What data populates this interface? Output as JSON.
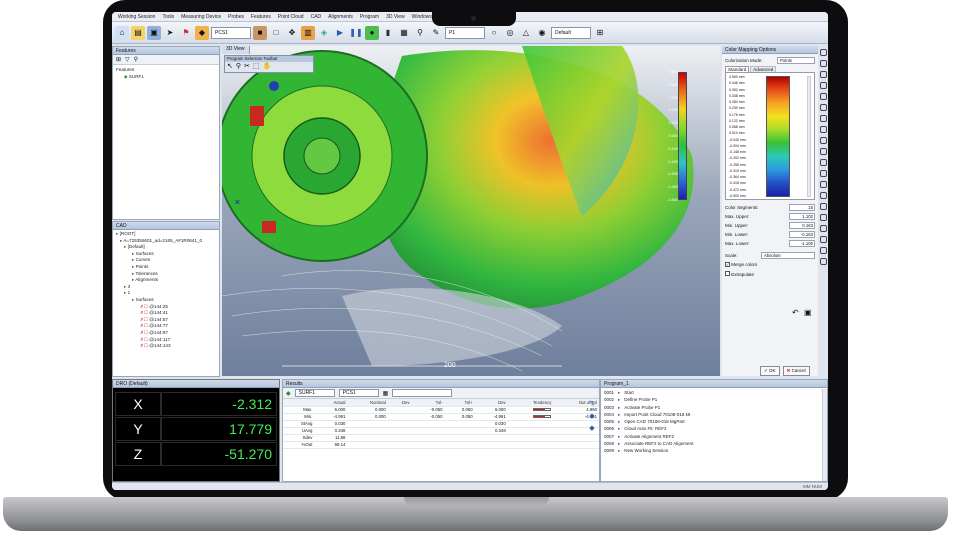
{
  "menu": [
    "Working Session",
    "Tools",
    "Measuring Device",
    "Probes",
    "Features",
    "Point Cloud",
    "CAD",
    "Alignments",
    "Program",
    "3D View",
    "Windows"
  ],
  "toolbar": {
    "frame_select": "PCS1",
    "probe_select": "P1",
    "view_select": "Default"
  },
  "features_panel": {
    "title": "Features",
    "items": [
      "Features",
      "SURF1"
    ]
  },
  "cad_panel": {
    "title": "CAD",
    "items": [
      "[ROOT]",
      "A=725355601_ad=2165_A#1R0641_0",
      "[Default]",
      "Surfaces",
      "Curves",
      "Points",
      "Tolerances",
      "Alignments",
      "3",
      "1",
      "Surfaces",
      "@144:25",
      "@144:41",
      "@144:57",
      "@144:77",
      "@144:97",
      "@144:117",
      "@144:143"
    ]
  },
  "view3d": {
    "tab": "3D View",
    "subwindow_title": "Program Selection Toolbar",
    "scale_label": "200"
  },
  "legend_values": [
    "0.500",
    "0.400",
    "0.300",
    "0.200",
    "0.100",
    "0.000",
    "-0.100",
    "-0.200",
    "-0.300",
    "-0.400",
    "-0.500"
  ],
  "color_mapping": {
    "title": "Color Mapping Options",
    "mode_label": "Colorization Mode:",
    "mode_value": "Points",
    "tabs": [
      "Standard",
      "Advanced"
    ],
    "segments_values": [
      "0.500 mm",
      "0.446 mm",
      "0.392 mm",
      "0.338 mm",
      "0.284 mm",
      "0.230 mm",
      "0.176 mm",
      "0.122 mm",
      "0.068 mm",
      "0.014 mm",
      "-0.040 mm",
      "-0.094 mm",
      "-0.148 mm",
      "-0.202 mm",
      "-0.256 mm",
      "-0.310 mm",
      "-0.364 mm",
      "-0.418 mm",
      "-0.472 mm",
      "-0.500 mm"
    ],
    "fields": [
      {
        "label": "Color Segments:",
        "value": "15"
      },
      {
        "label": "Max. Upper:",
        "value": "1.102"
      },
      {
        "label": "Min. Upper:",
        "value": "0.163"
      },
      {
        "label": "Min. Lower:",
        "value": "-0.163"
      },
      {
        "label": "Max. Lower:",
        "value": "-1.100"
      }
    ],
    "scale_label": "Scale:",
    "scale_value": "Absolute",
    "checks": [
      "Merge colors",
      "Extrapolate"
    ],
    "ok": "OK",
    "cancel": "Cancel"
  },
  "dro": {
    "title": "DRO (Default)",
    "rows": [
      {
        "axis": "X",
        "value": "-2.312"
      },
      {
        "axis": "Y",
        "value": "17.779"
      },
      {
        "axis": "Z",
        "value": "-51.270"
      }
    ]
  },
  "results": {
    "title": "Results",
    "feature": "SURF1",
    "frame": "PCS1",
    "columns": [
      "",
      "Actual",
      "Nominal",
      "Dev",
      "Tol-",
      "Tol+",
      "Dev",
      "Tendency",
      "Out of Tol"
    ],
    "rows": [
      [
        "Max.",
        "6.000",
        "0.000",
        "",
        "-0.050",
        "0.050",
        "6.000",
        "",
        "4.950"
      ],
      [
        "Min.",
        "-4.991",
        "0.000",
        "",
        "-0.050",
        "0.050",
        "-4.991",
        "",
        "-4.941"
      ],
      [
        "StAvg",
        "0.030",
        "",
        "",
        "",
        "",
        "0.030",
        "",
        ""
      ],
      [
        "UAvg",
        "0.348",
        "",
        "",
        "",
        "",
        "0.348",
        "",
        ""
      ],
      [
        "Sdev",
        "11.88",
        "",
        "",
        "",
        "",
        "",
        "",
        ""
      ],
      [
        "%Out",
        "68.14",
        "",
        "",
        "",
        "",
        "",
        "",
        ""
      ]
    ]
  },
  "program": {
    "title": "Program_1",
    "items": [
      {
        "n": "0001",
        "t": "Start"
      },
      {
        "n": "0002",
        "t": "Define Probe P1"
      },
      {
        "n": "0003",
        "t": "Activate Probe P1"
      },
      {
        "n": "0004",
        "t": "Import Point Cloud 70108-018 k6"
      },
      {
        "n": "0005",
        "t": "Open CAD 70108-018 MgPart"
      },
      {
        "n": "0006",
        "t": "Cloud Auto Fit: REF2"
      },
      {
        "n": "0007",
        "t": "Activate Alignment REF2"
      },
      {
        "n": "0008",
        "t": "Associate REF2 to CAD Alignment"
      },
      {
        "n": "0009",
        "t": "New Working Session"
      }
    ]
  },
  "status": {
    "mode": "MM  NUM"
  }
}
